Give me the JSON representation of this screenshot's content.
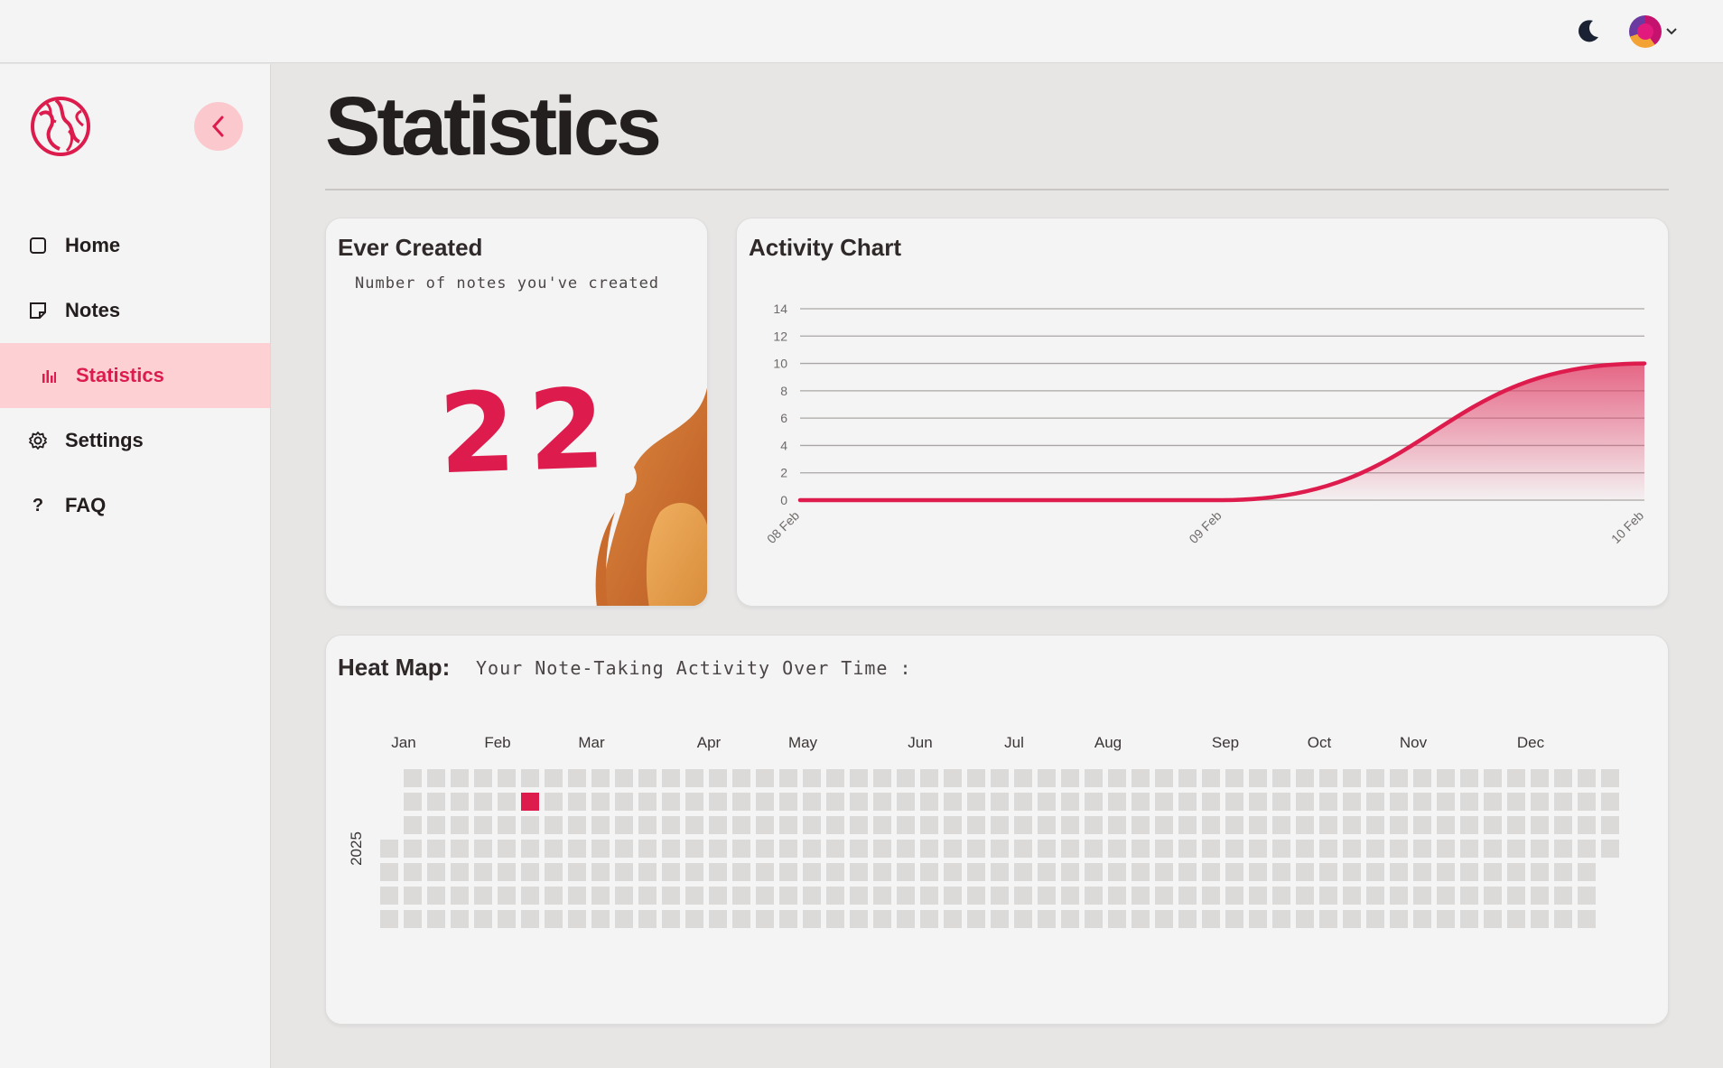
{
  "topbar": {
    "theme_toggle_icon": "moon-icon",
    "avatar_icon": "user-avatar",
    "avatar_menu_icon": "chevron-down-icon"
  },
  "sidebar": {
    "logo_icon": "brand-logo",
    "collapse_icon": "chevron-left-icon",
    "items": [
      {
        "label": "Home",
        "icon": "square-icon",
        "active": false
      },
      {
        "label": "Notes",
        "icon": "note-icon",
        "active": false
      },
      {
        "label": "Statistics",
        "icon": "bar-chart-icon",
        "active": true
      },
      {
        "label": "Settings",
        "icon": "gear-icon",
        "active": false
      },
      {
        "label": "FAQ",
        "icon": "question-icon",
        "active": false
      }
    ]
  },
  "page": {
    "title": "Statistics"
  },
  "ever_created": {
    "title": "Ever Created",
    "subtitle": "Number of notes you've created",
    "count": "22"
  },
  "activity_chart": {
    "title": "Activity Chart"
  },
  "heatmap": {
    "title": "Heat Map:",
    "subtitle": "Your Note-Taking Activity Over Time :"
  },
  "colors": {
    "accent": "#dd1c4d",
    "accent_soft": "#fdd0d4",
    "cell_empty": "#dcdad9"
  },
  "chart_data": [
    {
      "type": "area",
      "title": "Activity Chart",
      "x": [
        "08 Feb",
        "09 Feb",
        "10 Feb"
      ],
      "series": [
        {
          "values": [
            0,
            0,
            10
          ]
        }
      ],
      "ylim": [
        0,
        14
      ],
      "yticks": [
        0,
        2,
        4,
        6,
        8,
        10,
        12,
        14
      ],
      "xlabel": "",
      "ylabel": "",
      "grid": true,
      "color": "#dd1c4d"
    },
    {
      "type": "heatmap",
      "title": "Heat Map:",
      "year": "2025",
      "months": [
        "Jan",
        "Feb",
        "Mar",
        "Apr",
        "May",
        "Jun",
        "Jul",
        "Aug",
        "Sep",
        "Oct",
        "Nov",
        "Dec"
      ],
      "active_days": [
        {
          "date": "2025-02-10",
          "level": 1
        }
      ]
    }
  ]
}
